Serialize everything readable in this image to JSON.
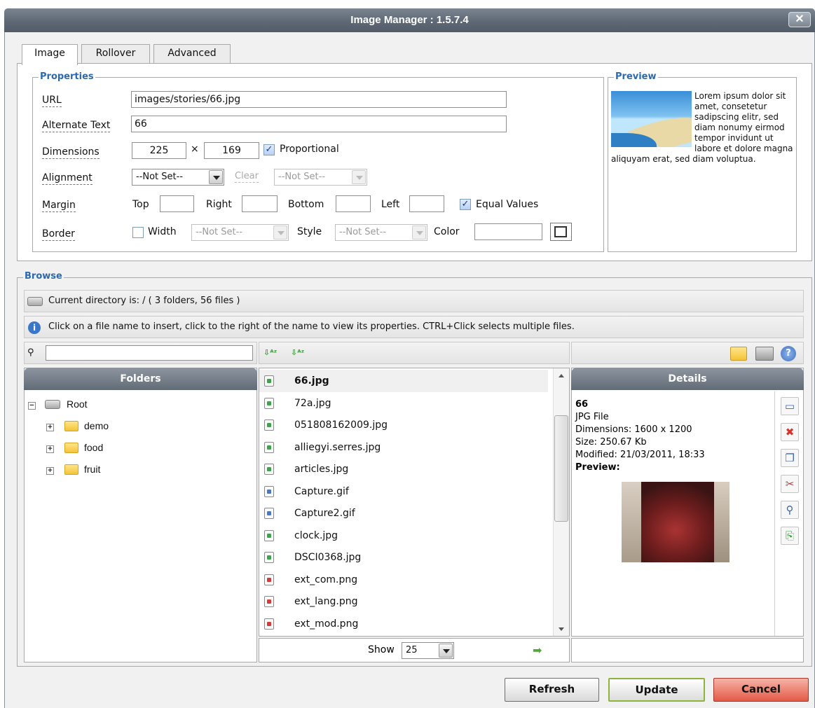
{
  "window": {
    "title": "Image Manager : 1.5.7.4",
    "close_label": "✕"
  },
  "tabs": [
    {
      "label": "Image"
    },
    {
      "label": "Rollover"
    },
    {
      "label": "Advanced"
    }
  ],
  "properties": {
    "legend": "Properties",
    "url_label": "URL",
    "url_value": "images/stories/66.jpg",
    "alt_label": "Alternate Text",
    "alt_value": "66",
    "dimensions_label": "Dimensions",
    "width_value": "225",
    "times": "×",
    "height_value": "169",
    "proportional_label": "Proportional",
    "proportional_checked": true,
    "alignment_label": "Alignment",
    "alignment_value": "--Not Set--",
    "clear_label": "Clear",
    "clear_value": "--Not Set--",
    "margin_label": "Margin",
    "margin_top_label": "Top",
    "margin_right_label": "Right",
    "margin_bottom_label": "Bottom",
    "margin_left_label": "Left",
    "equal_values_label": "Equal Values",
    "equal_values_checked": true,
    "border_label": "Border",
    "border_width_label": "Width",
    "border_width_value": "--Not Set--",
    "border_style_label": "Style",
    "border_style_value": "--Not Set--",
    "border_color_label": "Color",
    "border_color_value": ""
  },
  "preview": {
    "legend": "Preview",
    "text": "Lorem ipsum dolor sit amet, consetetur sadipscing elitr, sed diam nonumy eirmod tempor invidunt ut labore et dolore magna aliquyam erat, sed diam voluptua."
  },
  "browse": {
    "legend": "Browse",
    "current_dir": "Current directory is: / ( 3 folders, 56 files )",
    "info": "Click on a file name to insert, click to the right of the name to view its properties. CTRL+Click selects multiple files.",
    "search_value": "",
    "sort_icons": [
      "sort-az-icon",
      "sort-az-icon"
    ],
    "folders_header": "Folders",
    "tree": {
      "root": "Root",
      "folders": [
        "demo",
        "food",
        "fruit"
      ]
    },
    "files": [
      {
        "name": "66.jpg",
        "type": "jpg",
        "selected": true
      },
      {
        "name": "72a.jpg",
        "type": "jpg"
      },
      {
        "name": "051808162009.jpg",
        "type": "jpg"
      },
      {
        "name": "alliegyi.serres.jpg",
        "type": "jpg"
      },
      {
        "name": "articles.jpg",
        "type": "jpg"
      },
      {
        "name": "Capture.gif",
        "type": "gif"
      },
      {
        "name": "Capture2.gif",
        "type": "gif"
      },
      {
        "name": "clock.jpg",
        "type": "jpg"
      },
      {
        "name": "DSCI0368.jpg",
        "type": "jpg"
      },
      {
        "name": "ext_com.png",
        "type": "png"
      },
      {
        "name": "ext_lang.png",
        "type": "png"
      },
      {
        "name": "ext_mod.png",
        "type": "png"
      }
    ],
    "show_label": "Show",
    "show_value": "25",
    "details_header": "Details",
    "details": {
      "name": "66",
      "type": "JPG File",
      "dimensions": "Dimensions: 1600 x 1200",
      "size": "Size: 250.67 Kb",
      "modified": "Modified: 21/03/2011, 18:33",
      "preview_label": "Preview:"
    }
  },
  "buttons": {
    "refresh": "Refresh",
    "update": "Update",
    "cancel": "Cancel"
  },
  "colors": {
    "accent": "#2b6ab0",
    "titlebar": "#5e6975",
    "update_border": "#8eb53b",
    "cancel_bg": "#e35a47"
  }
}
